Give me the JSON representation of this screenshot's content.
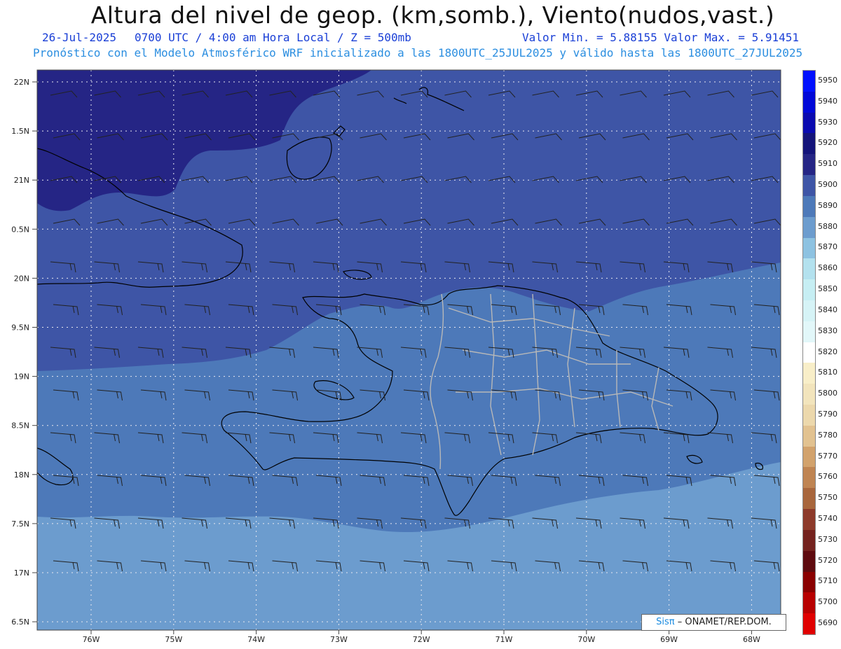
{
  "header": {
    "title": "Altura del nivel de geop. (km,somb.), Viento(nudos,vast.)",
    "line2_left": "26-Jul-2025",
    "line2_mid": "0700 UTC / 4:00 am Hora Local / Z = 500mb",
    "line2_right": "Valor Min. = 5.88155  Valor Max. = 5.91451",
    "line3": "Pronóstico con el Modelo Atmosférico WRF inicializado a las 1800UTC_25JUL2025 y válido hasta las  1800UTC_27JUL2025"
  },
  "axes": {
    "lat_labels": [
      "22N",
      "1.5N",
      "21N",
      "0.5N",
      "20N",
      "9.5N",
      "19N",
      "8.5N",
      "18N",
      "7.5N",
      "17N",
      "6.5N"
    ],
    "lon_labels": [
      "76W",
      "75W",
      "74W",
      "73W",
      "72W",
      "71W",
      "70W",
      "69W",
      "68W"
    ]
  },
  "colorbar": {
    "labels": [
      "5950",
      "5940",
      "5930",
      "5920",
      "5910",
      "5900",
      "5890",
      "5880",
      "5870",
      "5860",
      "5850",
      "5840",
      "5830",
      "5820",
      "5810",
      "5800",
      "5790",
      "5780",
      "5770",
      "5760",
      "5750",
      "5740",
      "5730",
      "5720",
      "5710",
      "5700",
      "5690"
    ],
    "colors": [
      "#0010ff",
      "#0008d8",
      "#0a0ab0",
      "#14147a",
      "#252585",
      "#3e55a6",
      "#4d79b9",
      "#6c9cce",
      "#8dc2e1",
      "#b3e1ee",
      "#c6eef3",
      "#d6f3f6",
      "#e2f7f9",
      "#ffffff",
      "#f8eec8",
      "#f2e4bc",
      "#ecd8ac",
      "#e2c290",
      "#d2a26c",
      "#bf8452",
      "#a8663c",
      "#8d3a2a",
      "#74221e",
      "#5e0a0e",
      "#8a0000",
      "#b80000",
      "#e00000"
    ]
  },
  "fill_colors": {
    "deep": "#252585",
    "main": "#3e55a6",
    "lower": "#4d79b9",
    "south": "#6c9cce"
  },
  "credit": {
    "brand": "Sisπ",
    "org": "– ONAMET/REP.DOM."
  }
}
